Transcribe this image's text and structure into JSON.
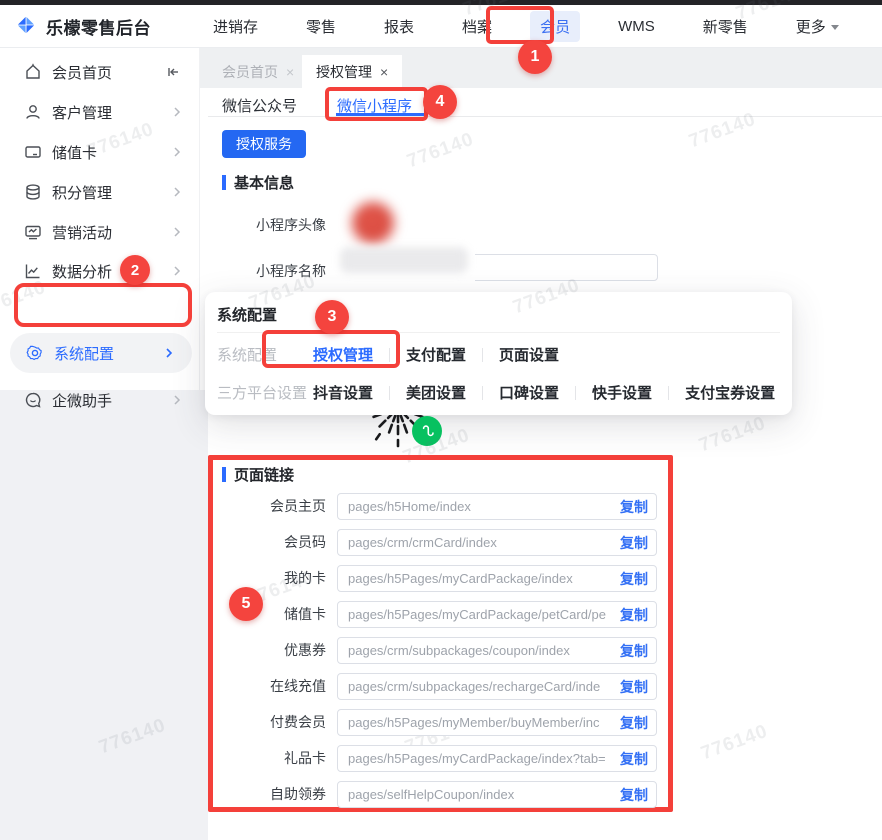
{
  "header": {
    "logo_text": "乐檬零售后台",
    "nav": [
      "进销存",
      "零售",
      "报表",
      "档案",
      "会员",
      "WMS",
      "新零售",
      "更多"
    ],
    "active_nav": "会员"
  },
  "tabs": [
    {
      "label": "会员首页",
      "close": "×"
    },
    {
      "label": "授权管理",
      "close": "×"
    }
  ],
  "sidebar": {
    "items": [
      "会员首页",
      "客户管理",
      "储值卡",
      "积分管理",
      "营销活动",
      "数据分析",
      "系统配置",
      "企微助手"
    ],
    "selected": "系统配置"
  },
  "subtabs": {
    "official": "微信公众号",
    "miniprogram": "微信小程序"
  },
  "authorize_button": "授权服务",
  "sections": {
    "basic_info": "基本信息",
    "page_links": "页面链接"
  },
  "form": {
    "avatar_label": "小程序头像",
    "name_label": "小程序名称"
  },
  "popup": {
    "title": "系统配置",
    "group1": {
      "label": "系统配置",
      "items": [
        "授权管理",
        "支付配置",
        "页面设置"
      ]
    },
    "group2": {
      "label": "三方平台设置",
      "items": [
        "抖音设置",
        "美团设置",
        "口碑设置",
        "快手设置",
        "支付宝券设置"
      ]
    }
  },
  "page_links": {
    "copy_label": "复制",
    "rows": [
      {
        "label": "会员主页",
        "path": "pages/h5Home/index"
      },
      {
        "label": "会员码",
        "path": "pages/crm/crmCard/index"
      },
      {
        "label": "我的卡",
        "path": "pages/h5Pages/myCardPackage/index"
      },
      {
        "label": "储值卡",
        "path": "pages/h5Pages/myCardPackage/petCard/pe"
      },
      {
        "label": "优惠券",
        "path": "pages/crm/subpackages/coupon/index"
      },
      {
        "label": "在线充值",
        "path": "pages/crm/subpackages/rechargeCard/inde"
      },
      {
        "label": "付费会员",
        "path": "pages/h5Pages/myMember/buyMember/inc"
      },
      {
        "label": "礼品卡",
        "path": "pages/h5Pages/myCardPackage/index?tab="
      },
      {
        "label": "自助领券",
        "path": "pages/selfHelpCoupon/index"
      }
    ]
  },
  "annotations": {
    "badges": [
      "1",
      "2",
      "3",
      "4",
      "5"
    ]
  },
  "watermark": {
    "text": "776140"
  },
  "colors": {
    "accent": "#2b6bff",
    "annotation": "#f4403a",
    "button_blue": "#2468f2",
    "wechat_green": "#07c160"
  }
}
